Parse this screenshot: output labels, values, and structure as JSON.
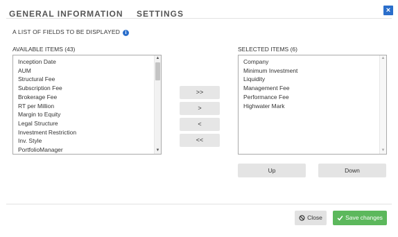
{
  "tabs": [
    {
      "label": "GENERAL INFORMATION"
    },
    {
      "label": "SETTINGS"
    }
  ],
  "close_x": "×",
  "list_title": "A LIST OF FIELDS TO BE DISPLAYED",
  "info_glyph": "i",
  "available": {
    "label": "AVAILABLE ITEMS (43)",
    "items": [
      "Inception Date",
      "AUM",
      "Structural Fee",
      "Subscription Fee",
      "Brokerage Fee",
      "RT per Million",
      "Margin to Equity",
      "Legal Structure",
      "Investment Restriction",
      "Inv. Style",
      "PortfolioManager"
    ],
    "scroll_position": 0
  },
  "selected": {
    "label": "SELECTED ITEMS (6)",
    "items": [
      "Company",
      "Minimum Investment",
      "Liquidity",
      "Management Fee",
      "Performance Fee",
      "Highwater Mark"
    ]
  },
  "move_buttons": {
    "add_all": ">>",
    "add": ">",
    "remove": "<",
    "remove_all": "<<"
  },
  "order_buttons": {
    "up": "Up",
    "down": "Down"
  },
  "footer": {
    "close_label": "Close",
    "save_label": "Save changes"
  },
  "colors": {
    "accent": "#2a6ecb",
    "save": "#5cb85c"
  }
}
